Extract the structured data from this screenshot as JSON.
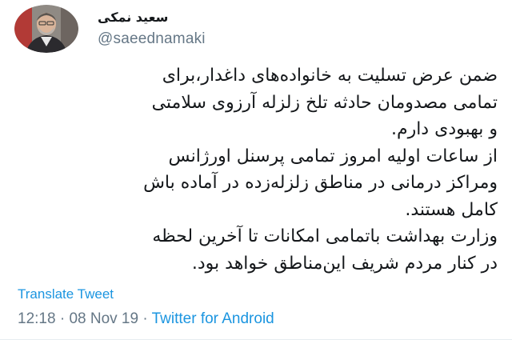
{
  "tweet": {
    "display_name": "سعید نمکی",
    "handle": "@saeednamaki",
    "body_lines": [
      "ضمن عرض تسلیت به خانواده‌های داغدار،برای",
      "تمامی مصدومان حادثه تلخ زلزله آرزوی سلامتی",
      "و بهبودی دارم.",
      "از ساعات اولیه امروز تمامی پرسنل اورژانس",
      "ومراکز درمانی در مناطق زلزله‌زده در آماده باش",
      "کامل هستند.",
      "وزارت بهداشت باتمامی امکانات تا آخرین لحظه",
      "در کنار مردم شریف این‌مناطق خواهد بود."
    ],
    "translate_label": "Translate Tweet",
    "time": "12:18",
    "separator_1": "·",
    "date": "08 Nov 19",
    "separator_2": "·",
    "source": "Twitter for Android"
  },
  "colors": {
    "link": "#1b95e0",
    "meta": "#657786",
    "text": "#14171a"
  },
  "icons": {
    "avatar": "profile-photo"
  }
}
